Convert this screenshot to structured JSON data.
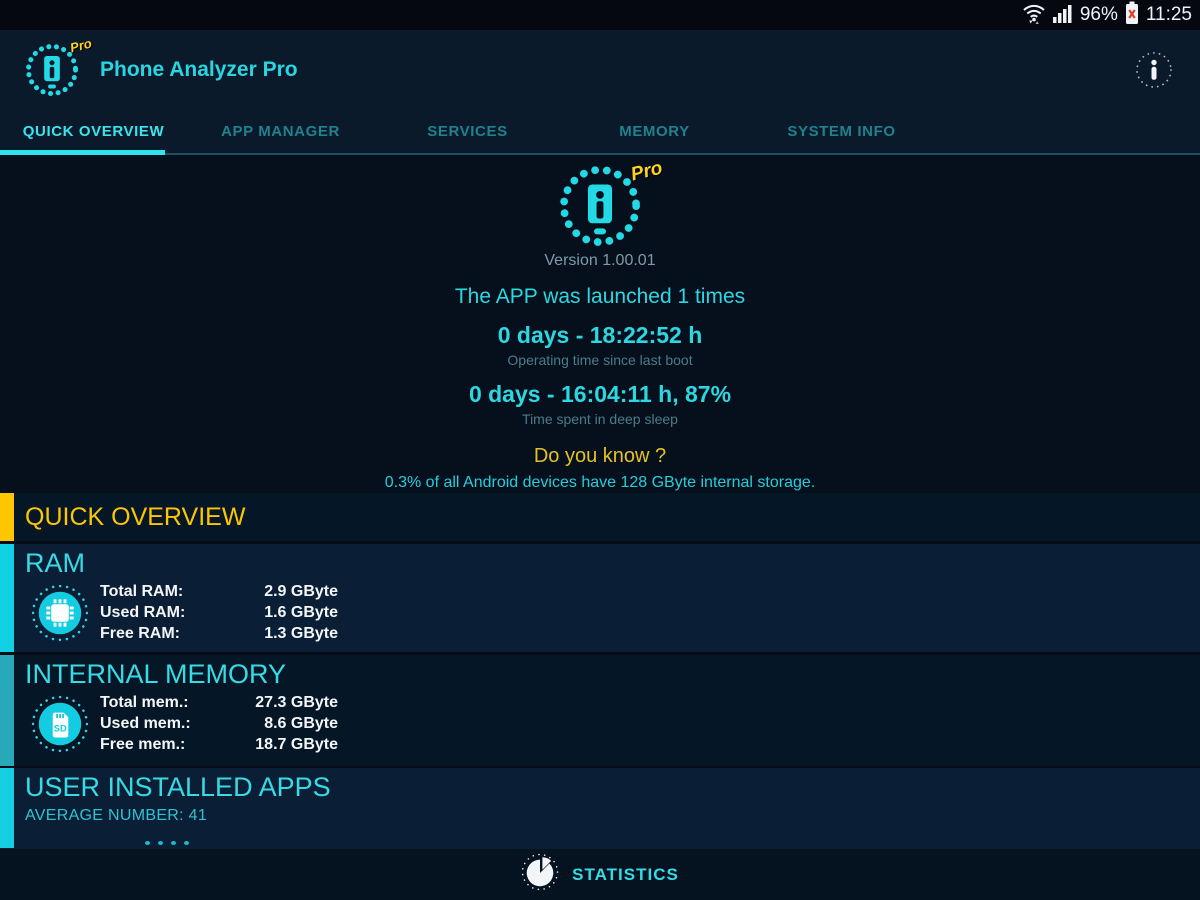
{
  "status_bar": {
    "battery_percent": "96%",
    "time": "11:25"
  },
  "header": {
    "app_title": "Phone Analyzer Pro",
    "pro_badge": "Pro"
  },
  "tabs": [
    {
      "label": "QUICK OVERVIEW",
      "active": true
    },
    {
      "label": "APP MANAGER",
      "active": false
    },
    {
      "label": "SERVICES",
      "active": false
    },
    {
      "label": "MEMORY",
      "active": false
    },
    {
      "label": "SYSTEM INFO",
      "active": false
    }
  ],
  "overview": {
    "version": "Version 1.00.01",
    "launched": "The APP was launched 1 times",
    "uptime_value": "0 days - 18:22:52 h",
    "uptime_label": "Operating time since last boot",
    "deep_sleep_value": "0 days - 16:04:11 h, 87%",
    "deep_sleep_label": "Time spent in deep sleep",
    "fact_title": "Do you know ?",
    "fact_text": "0.3% of all Android devices have 128 GByte internal storage."
  },
  "sections": {
    "quick_overview_title": "QUICK OVERVIEW",
    "ram": {
      "title": "RAM",
      "rows": [
        {
          "label": "Total RAM:",
          "value": "2.9 GByte"
        },
        {
          "label": "Used RAM:",
          "value": "1.6 GByte"
        },
        {
          "label": "Free RAM:",
          "value": "1.3 GByte"
        }
      ]
    },
    "internal_memory": {
      "title": "INTERNAL MEMORY",
      "rows": [
        {
          "label": "Total mem.:",
          "value": "27.3 GByte"
        },
        {
          "label": "Used mem.:",
          "value": "8.6 GByte"
        },
        {
          "label": "Free mem.:",
          "value": "18.7 GByte"
        }
      ]
    },
    "user_apps": {
      "title": "USER INSTALLED APPS",
      "subtitle": "AVERAGE NUMBER: 41"
    }
  },
  "bottom_bar": {
    "statistics_label": "STATISTICS"
  },
  "colors": {
    "accent": "#22d9e5",
    "yellow": "#fcc600",
    "battery_alert": "#e03c2f"
  }
}
